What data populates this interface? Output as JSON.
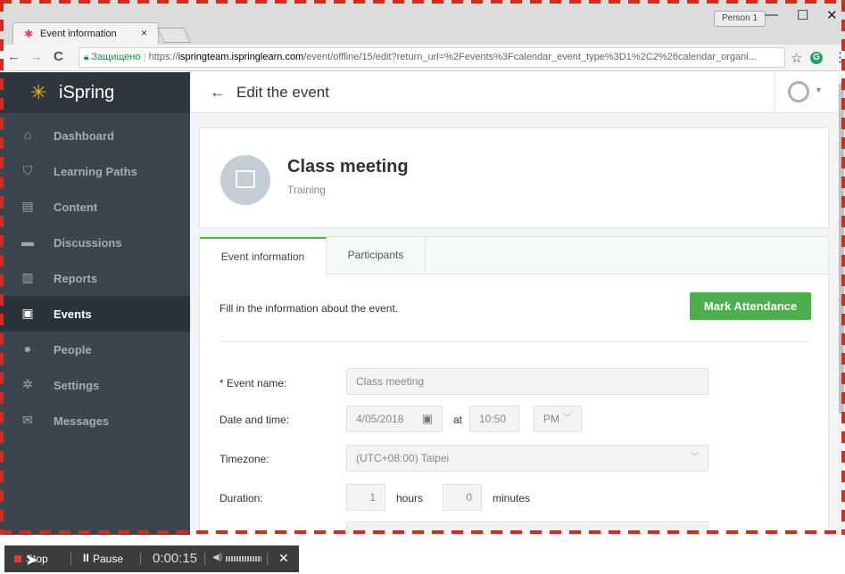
{
  "browser": {
    "tab_title": "Event information",
    "tab_close": "×",
    "profile": "Person 1",
    "window_controls": {
      "minimize": "—",
      "maximize": "☐",
      "close": "✕"
    },
    "nav": {
      "back": "←",
      "forward": "→",
      "reload": "C"
    },
    "secure_label": "Защищено",
    "url_scheme": "https://",
    "url_host": "ispringteam.ispringlearn.com",
    "url_path": "/event/offline/15/edit?return_url=%2Fevents%3Fcalendar_event_type%3D1%2C2%26calendar_organi..."
  },
  "sidebar": {
    "brand": "iSpring",
    "items": [
      {
        "label": "Dashboard",
        "icon": "home-icon",
        "glyph": "⌂"
      },
      {
        "label": "Learning Paths",
        "icon": "graduation-cap-icon",
        "glyph": "⛉"
      },
      {
        "label": "Content",
        "icon": "document-icon",
        "glyph": "▤"
      },
      {
        "label": "Discussions",
        "icon": "chat-icon",
        "glyph": "▬"
      },
      {
        "label": "Reports",
        "icon": "bar-chart-icon",
        "glyph": "▥"
      },
      {
        "label": "Events",
        "icon": "calendar-icon",
        "glyph": "▣",
        "active": true
      },
      {
        "label": "People",
        "icon": "person-icon",
        "glyph": "●"
      },
      {
        "label": "Settings",
        "icon": "gear-icon",
        "glyph": "✲"
      },
      {
        "label": "Messages",
        "icon": "envelope-icon",
        "glyph": "✉"
      }
    ]
  },
  "header": {
    "title": "Edit the event",
    "back": "←"
  },
  "event": {
    "title": "Class meeting",
    "type": "Training"
  },
  "tabs": {
    "info": "Event information",
    "participants": "Participants"
  },
  "form": {
    "hint": "Fill in the information about the event.",
    "mark_attendance": "Mark Attendance",
    "event_name_label": "* Event name:",
    "event_name_value": "Class meeting",
    "date_time_label": "Date and time:",
    "date_value": "4/05/2018",
    "at": "at",
    "time_value": "10:50",
    "ampm_value": "PM",
    "timezone_label": "Timezone:",
    "timezone_value": "(UTC+08:00) Taipei",
    "duration_label": "Duration:",
    "hours_value": "1",
    "hours_label": "hours",
    "minutes_value": "0",
    "minutes_label": "minutes"
  },
  "recorder": {
    "stop": "Stop",
    "pause": "Pause",
    "time": "0:00:15",
    "close": "✕"
  },
  "colors": {
    "accent_green": "#4cae4c",
    "sidebar": "#3b4550",
    "dash_border": "#d8291e"
  }
}
